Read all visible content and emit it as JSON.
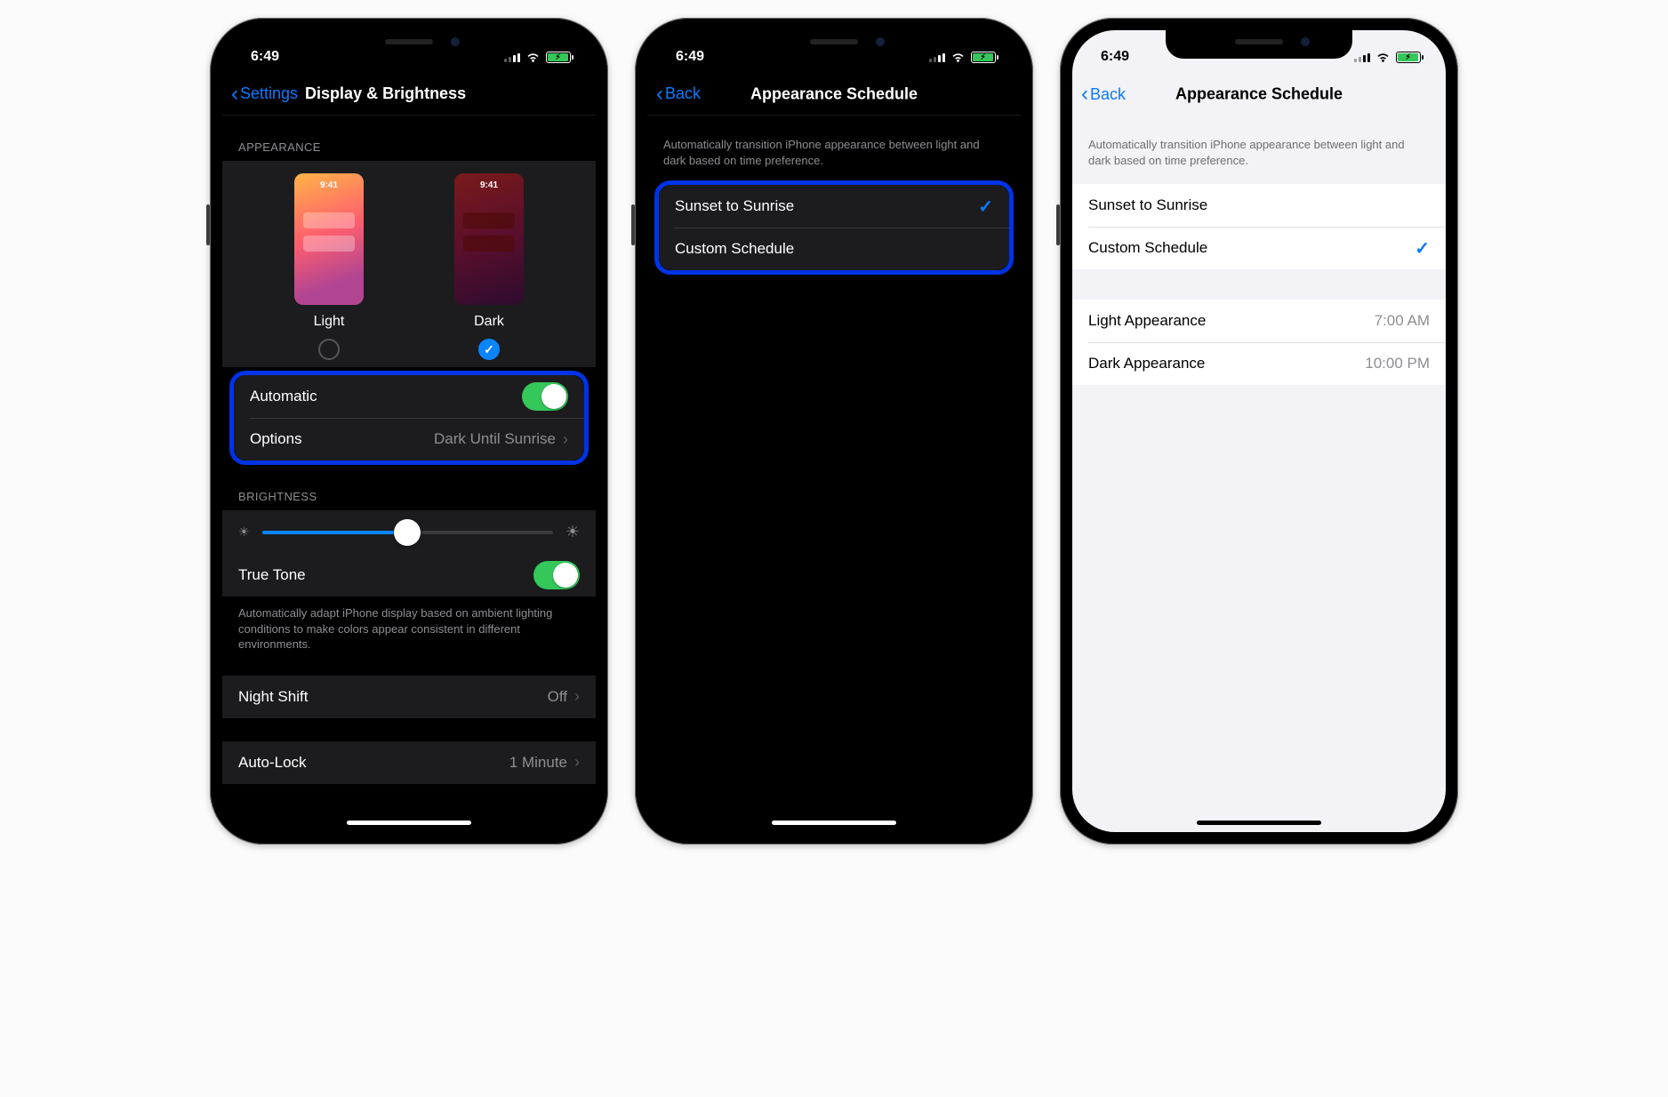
{
  "status": {
    "time": "6:49",
    "battery_pct": 88
  },
  "phone1": {
    "back_label": "Settings",
    "title": "Display & Brightness",
    "appearance_header": "APPEARANCE",
    "thumb_time": "9:41",
    "light_label": "Light",
    "dark_label": "Dark",
    "automatic_label": "Automatic",
    "automatic_on": true,
    "options_label": "Options",
    "options_value": "Dark Until Sunrise",
    "brightness_header": "BRIGHTNESS",
    "brightness_pct": 50,
    "truetone_label": "True Tone",
    "truetone_on": true,
    "truetone_desc": "Automatically adapt iPhone display based on ambient lighting conditions to make colors appear consistent in different environments.",
    "nightshift_label": "Night Shift",
    "nightshift_value": "Off",
    "autolock_label": "Auto-Lock",
    "autolock_value": "1 Minute"
  },
  "phone2": {
    "back_label": "Back",
    "title": "Appearance Schedule",
    "desc": "Automatically transition iPhone appearance between light and dark based on time preference.",
    "opt1": "Sunset to Sunrise",
    "opt2": "Custom Schedule",
    "selected": "opt1"
  },
  "phone3": {
    "back_label": "Back",
    "title": "Appearance Schedule",
    "desc": "Automatically transition iPhone appearance between light and dark based on time preference.",
    "opt1": "Sunset to Sunrise",
    "opt2": "Custom Schedule",
    "selected": "opt2",
    "light_row_label": "Light Appearance",
    "light_row_value": "7:00 AM",
    "dark_row_label": "Dark Appearance",
    "dark_row_value": "10:00 PM"
  }
}
